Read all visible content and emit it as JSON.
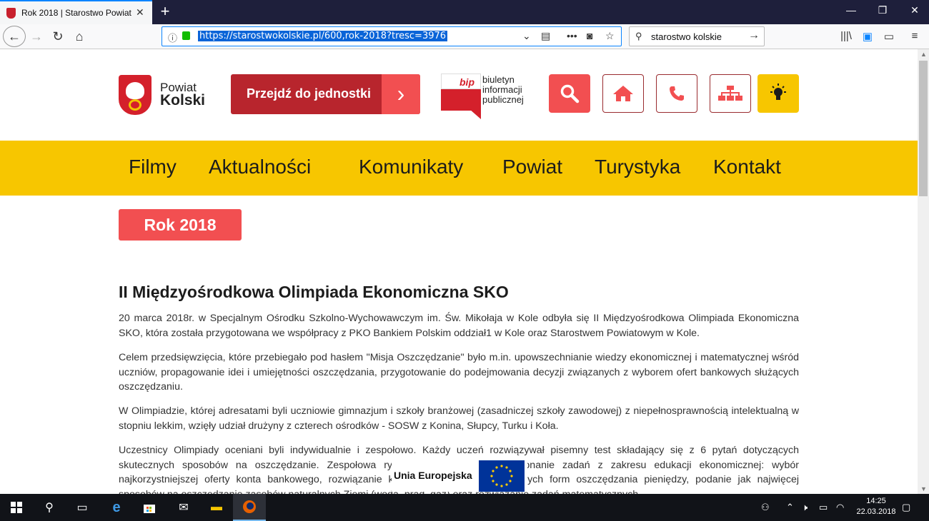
{
  "browser": {
    "tab_title": "Rok 2018 | Starostwo Powiatowe",
    "url": "https://starostwokolskie.pl/600,rok-2018?tresc=3976",
    "search_text": "starostwo kolskie",
    "icons": [
      "back-icon",
      "forward-icon",
      "reload-icon",
      "home-icon",
      "info-icon",
      "lock-icon",
      "chevron-down-icon",
      "reader-icon",
      "more-icon",
      "pocket-icon",
      "star-icon",
      "search-icon",
      "library-icon",
      "sync-icon",
      "sidebar-icon",
      "menu-icon"
    ]
  },
  "header": {
    "logo_line1": "Powiat",
    "logo_line2": "Kolski",
    "goto_button": "Przejdź do jednostki",
    "bip_mark": "bip",
    "bip_text": "biuletyn informacji publicznej",
    "icons": [
      "search-icon",
      "home-icon",
      "phone-icon",
      "sitemap-icon",
      "bulb-icon"
    ],
    "accent_red": "#f24f51",
    "accent_yellow": "#f7c600"
  },
  "menu": {
    "items": [
      "Filmy",
      "Aktualności",
      "Komunikaty",
      "Powiat",
      "Turystyka",
      "Kontakt"
    ]
  },
  "category_pill": "Rok 2018",
  "article": {
    "title": "II Międzyośrodkowa Olimpiada Ekonomiczna SKO",
    "paragraphs": [
      "20 marca 2018r. w Specjalnym Ośrodku Szkolno-Wychowawczym im. Św. Mikołaja w Kole odbyła się II Międzyośrodkowa Olimpiada Ekonomiczna SKO, która została przygotowana we współpracy z PKO Bankiem Polskim oddział1 w Kole oraz Starostwem Powiatowym w Kole.",
      "Celem przedsięwzięcia, które przebiegało pod hasłem \"Misja Oszczędzanie\" było m.in. upowszechnianie wiedzy ekonomicznej i matematycznej wśród uczniów, propagowanie idei i umiejętności oszczędzania, przygotowanie do podejmowania decyzji związanych z wyborem ofert bankowych służących oszczędzaniu.",
      "W Olimpiadzie, której adresatami byli uczniowie gimnazjum i szkoły branżowej (zasadniczej szkoły zawodowej) z niepełnosprawnością intelektualną w stopniu lekkim, wzięły udział drużyny z czterech ośrodków - SOSW z Konina, Słupcy, Turku i Koła.",
      "Uczestnicy Olimpiady oceniani byli indywidualnie i zespołowo. Każdy uczeń rozwiązywał pisemny test składający się z 6 pytań dotyczących skutecznych sposobów na oszczędzanie. Zespołowa rywalizacja polegała na wykonanie zadań z zakresu edukacji ekonomicznej: wybór najkorzystniejszej oferty konta bankowego, rozwiązanie krzyżówki, dopasowanie różnych form oszczędzania pieniędzy, podanie jak najwięcej sposobów na oszczędzanie zasobów naturalnych Ziemi (woda, prąd, gaz) oraz rozwiązanie zadań matematycznych."
    ]
  },
  "eu_badge": "Unia Europejska",
  "taskbar": {
    "time": "14:25",
    "date": "22.03.2018",
    "icons": [
      "windows-start-icon",
      "search-icon",
      "task-view-icon",
      "edge-icon",
      "store-icon",
      "mail-icon",
      "file-explorer-icon",
      "firefox-icon"
    ]
  }
}
